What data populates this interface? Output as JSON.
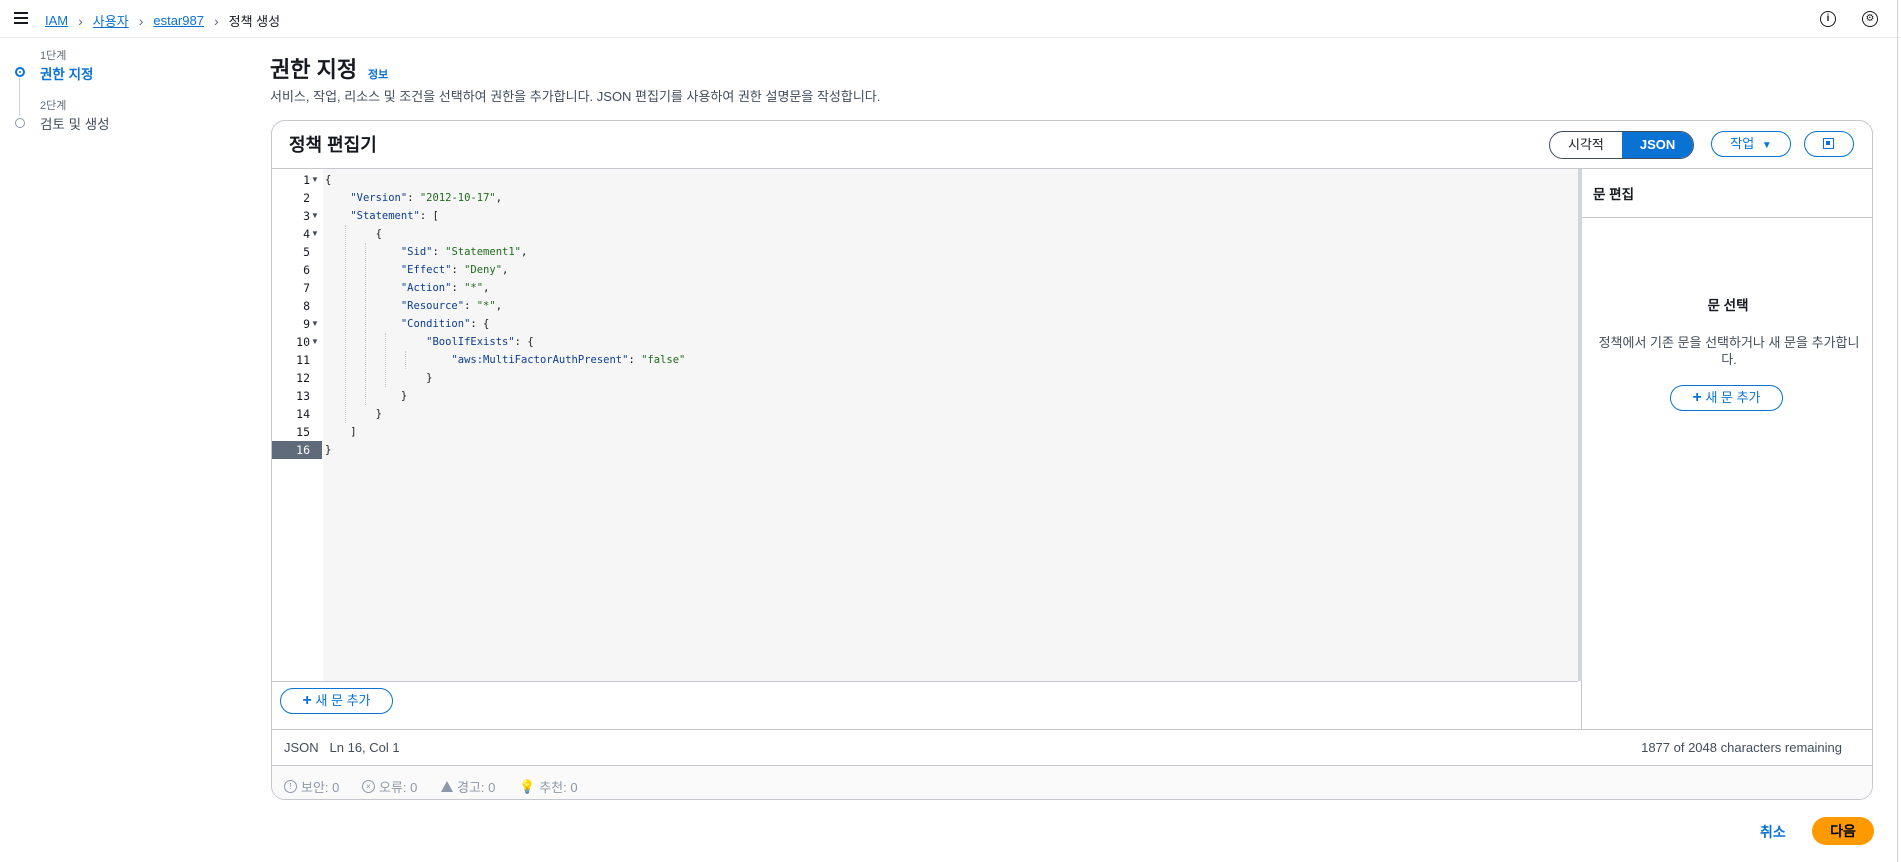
{
  "breadcrumb": {
    "items": [
      "IAM",
      "사용자",
      "estar987"
    ],
    "current": "정책 생성"
  },
  "topbar": {
    "info_icon": "i",
    "settings_icon": "gear-icon"
  },
  "steps": [
    {
      "num": "1단계",
      "label": "권한 지정",
      "active": true
    },
    {
      "num": "2단계",
      "label": "검토 및 생성",
      "active": false
    }
  ],
  "header": {
    "title": "권한 지정",
    "info": "정보",
    "description": "서비스, 작업, 리소스 및 조건을 선택하여 권한을 추가합니다. JSON 편집기를 사용하여 권한 설명문을 작성합니다."
  },
  "editor": {
    "title": "정책 편집기",
    "modes": [
      "시각적",
      "JSON"
    ],
    "selected_mode": "JSON",
    "action_label": "작업",
    "line_numbers": [
      "1",
      "2",
      "3",
      "4",
      "5",
      "6",
      "7",
      "8",
      "9",
      "10",
      "11",
      "12",
      "13",
      "14",
      "15",
      "16"
    ],
    "code_lines": [
      "{",
      "    \"Version\": \"2012-10-17\",",
      "    \"Statement\": [",
      "        {",
      "            \"Sid\": \"Statement1\",",
      "            \"Effect\": \"Deny\",",
      "            \"Action\": \"*\",",
      "            \"Resource\": \"*\",",
      "            \"Condition\": {",
      "                \"BoolIfExists\": {",
      "                    \"aws:MultiFactorAuthPresent\": \"false\"",
      "                }",
      "            }",
      "        }",
      "    ]",
      "}"
    ],
    "add_statement": "새 문 추가",
    "status_mode": "JSON",
    "status_position": "Ln 16, Col 1",
    "chars_remaining": "1877 of 2048 characters remaining"
  },
  "diagnostics": {
    "security": "보안: 0",
    "errors": "오류: 0",
    "warnings": "경고: 0",
    "suggestions": "추천: 0"
  },
  "statement_panel": {
    "title": "문 편집",
    "select_title": "문 선택",
    "description": "정책에서 기존 문을 선택하거나 새 문을 추가합니다.",
    "add_label": "새 문 추가"
  },
  "footer": {
    "cancel": "취소",
    "next": "다음"
  }
}
